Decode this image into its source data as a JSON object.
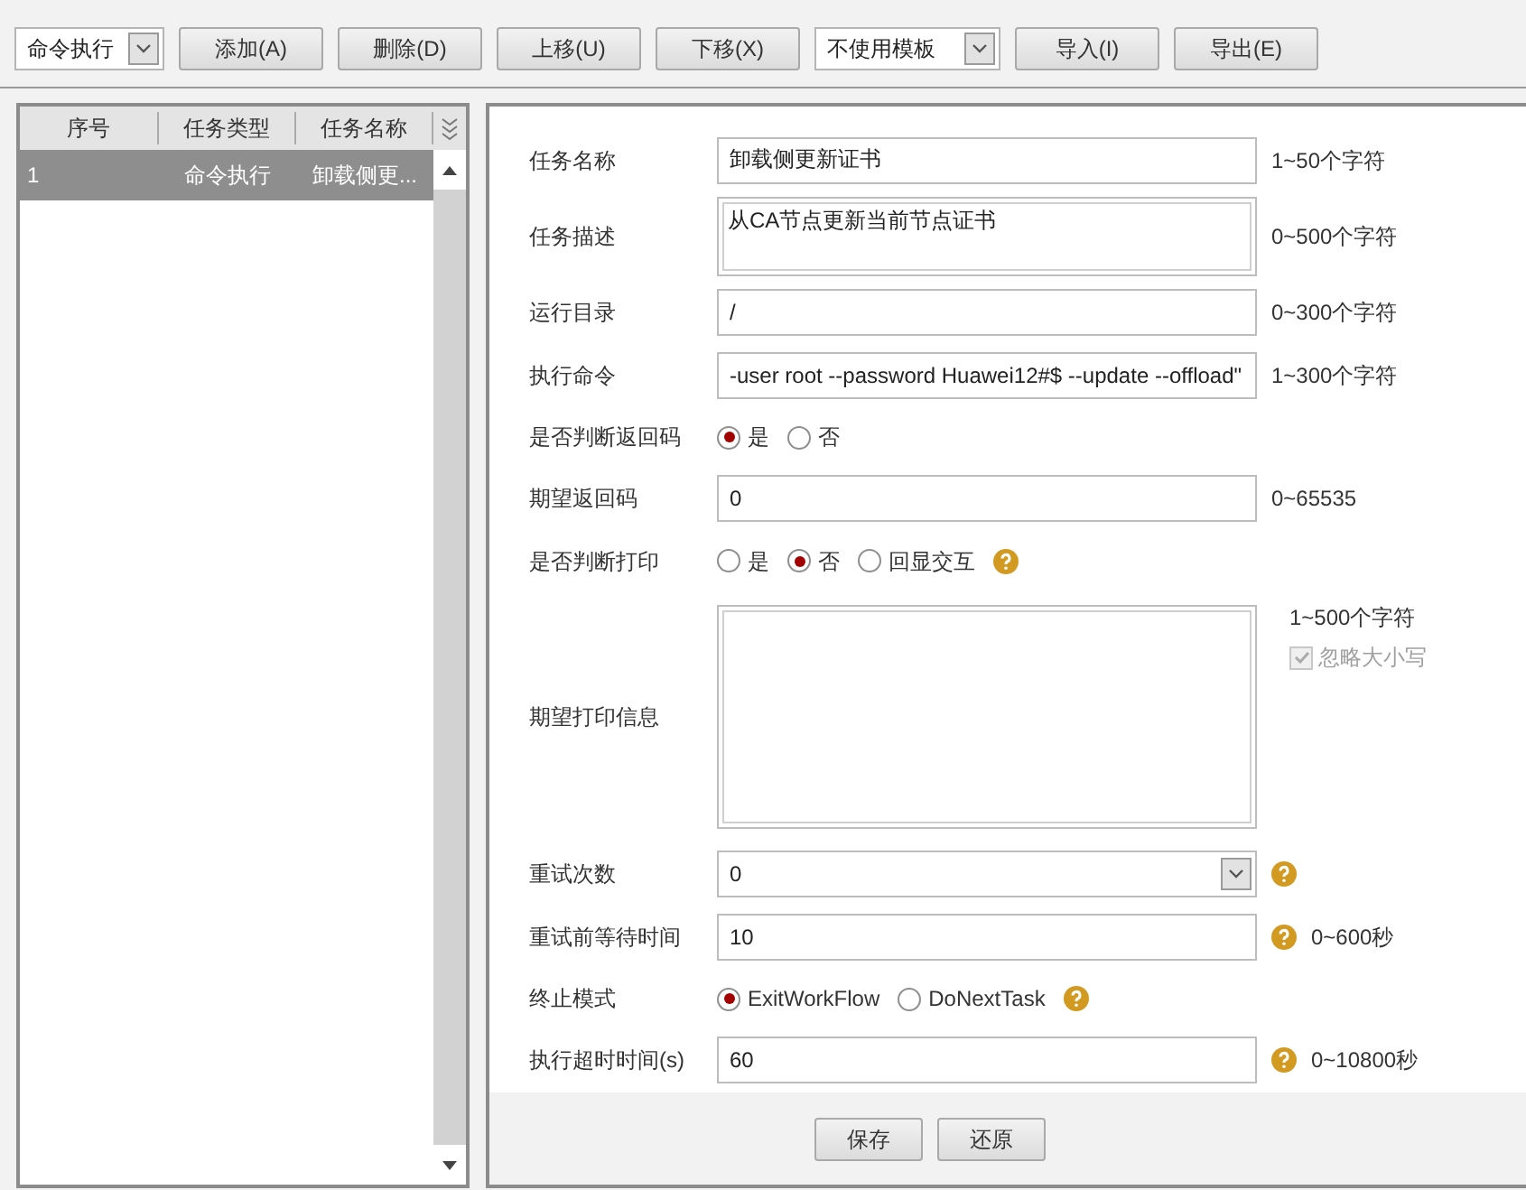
{
  "toolbar": [
    {
      "kind": "select",
      "value": "命令执行"
    },
    {
      "kind": "button",
      "label": "添加(A)"
    },
    {
      "kind": "button",
      "label": "删除(D)"
    },
    {
      "kind": "button",
      "label": "上移(U)"
    },
    {
      "kind": "button",
      "label": "下移(X)"
    },
    {
      "kind": "select",
      "value": "不使用模板"
    },
    {
      "kind": "button",
      "label": "导入(I)"
    },
    {
      "kind": "button",
      "label": "导出(E)"
    }
  ],
  "task_table": {
    "columns": [
      "序号",
      "任务类型",
      "任务名称"
    ],
    "rows": [
      {
        "cells": [
          "1",
          "命令执行",
          "卸载侧更..."
        ],
        "selected": true
      }
    ]
  },
  "form": [
    {
      "kind": "text",
      "label": "任务名称",
      "value": "卸载侧更新证书",
      "hint": "1~50个字符"
    },
    {
      "kind": "textarea",
      "label": "任务描述",
      "value": "从CA节点更新当前节点证书",
      "hint": "0~500个字符"
    },
    {
      "kind": "text",
      "label": "运行目录",
      "value": "/",
      "hint": "0~300个字符"
    },
    {
      "kind": "text",
      "label": "执行命令",
      "value": "-user root --password Huawei12#$ --update --offload\"",
      "hint": "1~300个字符"
    },
    {
      "kind": "radio",
      "label": "是否判断返回码",
      "options": [
        {
          "label": "是",
          "selected": true
        },
        {
          "label": "否",
          "selected": false
        }
      ]
    },
    {
      "kind": "text",
      "label": "期望返回码",
      "value": "0",
      "hint": "0~65535"
    },
    {
      "kind": "radio",
      "label": "是否判断打印",
      "options": [
        {
          "label": "是",
          "selected": false
        },
        {
          "label": "否",
          "selected": true
        },
        {
          "label": "回显交互",
          "selected": false
        }
      ],
      "help": true
    },
    {
      "kind": "bigarea",
      "label": "期望打印信息",
      "hint": "1~500个字符",
      "check": {
        "label": "忽略大小写",
        "checked": true,
        "disabled": true
      }
    },
    {
      "kind": "select",
      "label": "重试次数",
      "value": "0",
      "help": true
    },
    {
      "kind": "text",
      "label": "重试前等待时间",
      "value": "10",
      "hint": "0~600秒",
      "help": true
    },
    {
      "kind": "radio",
      "label": "终止模式",
      "options": [
        {
          "label": "ExitWorkFlow",
          "selected": true
        },
        {
          "label": "DoNextTask",
          "selected": false
        }
      ],
      "help": true
    },
    {
      "kind": "text",
      "label": "执行超时时间(s)",
      "value": "60",
      "hint": "0~10800秒",
      "help": true
    }
  ],
  "footer_buttons": [
    "保存",
    "还原"
  ]
}
